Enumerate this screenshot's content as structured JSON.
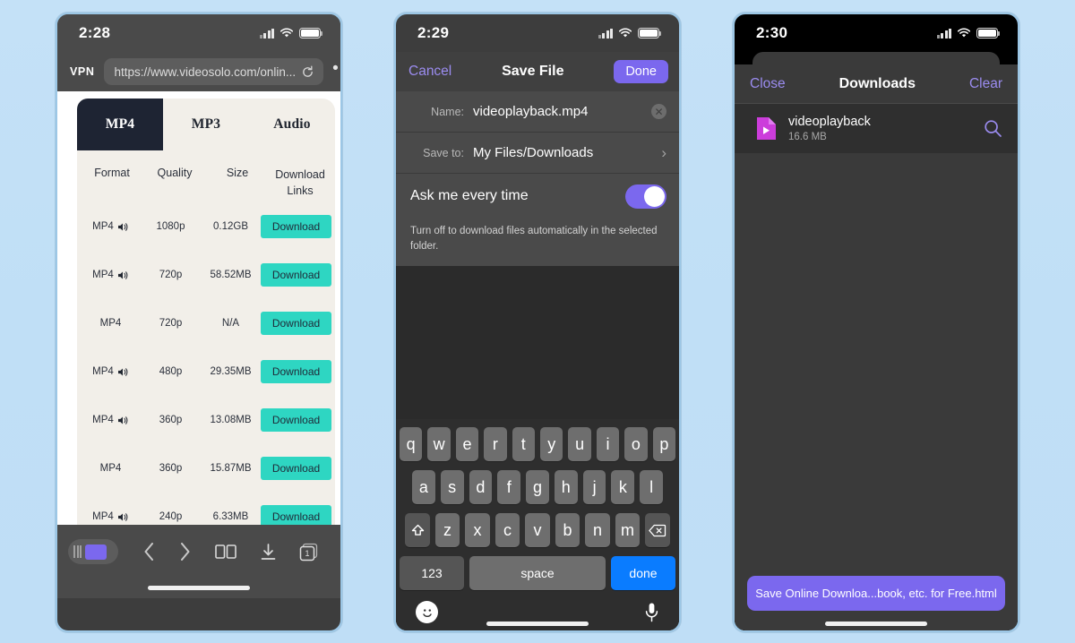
{
  "background_color": "#c0dff6",
  "phone1": {
    "name": "browser-phone",
    "statusbar": {
      "time": "2:28",
      "signal_icon": "cellular-bars-icon",
      "wifi_icon": "wifi-icon",
      "battery_icon": "battery-icon"
    },
    "browser": {
      "vpn_label": "VPN",
      "url": "https://www.videosolo.com/onlin...",
      "reload_icon": "reload-icon",
      "more_icon": "more-dots-icon"
    },
    "tabs": [
      {
        "label": "MP4",
        "active": true
      },
      {
        "label": "MP3",
        "active": false
      },
      {
        "label": "Audio",
        "active": false
      }
    ],
    "table": {
      "headers": [
        "Format",
        "Quality",
        "Size",
        "Download Links"
      ],
      "header_download_line1": "Download",
      "header_download_line2": "Links",
      "rows": [
        {
          "format": "MP4",
          "has_audio_icon": true,
          "quality": "1080p",
          "size": "0.12GB",
          "action": "Download"
        },
        {
          "format": "MP4",
          "has_audio_icon": true,
          "quality": "720p",
          "size": "58.52MB",
          "action": "Download"
        },
        {
          "format": "MP4",
          "has_audio_icon": false,
          "quality": "720p",
          "size": "N/A",
          "action": "Download"
        },
        {
          "format": "MP4",
          "has_audio_icon": true,
          "quality": "480p",
          "size": "29.35MB",
          "action": "Download"
        },
        {
          "format": "MP4",
          "has_audio_icon": true,
          "quality": "360p",
          "size": "13.08MB",
          "action": "Download"
        },
        {
          "format": "MP4",
          "has_audio_icon": false,
          "quality": "360p",
          "size": "15.87MB",
          "action": "Download"
        },
        {
          "format": "MP4",
          "has_audio_icon": true,
          "quality": "240p",
          "size": "6.33MB",
          "action": "Download"
        }
      ]
    },
    "toolbar": {
      "vpn_pill_icon": "vpn-shield-icon",
      "back_icon": "chevron-left-icon",
      "forward_icon": "chevron-right-icon",
      "bookmarks_icon": "book-icon",
      "downloads_icon": "download-arrow-icon",
      "tabs_icon": "tabs-icon",
      "tabs_count": "1"
    },
    "accent_download_button": "#2ed6c2",
    "active_tab_color": "#1e2433",
    "card_background": "#f2efe9"
  },
  "phone2": {
    "name": "save-file-phone",
    "statusbar": {
      "time": "2:29",
      "signal_icon": "cellular-bars-icon",
      "wifi_icon": "wifi-icon",
      "battery_icon": "battery-icon"
    },
    "nav": {
      "cancel_label": "Cancel",
      "title": "Save File",
      "done_label": "Done"
    },
    "fields": [
      {
        "label": "Name:",
        "value": "videoplayback.mp4",
        "clear_icon": "clear-circle-icon"
      },
      {
        "label": "Save to:",
        "value": "My Files/Downloads",
        "chevron_icon": "chevron-right-icon"
      }
    ],
    "toggle": {
      "label": "Ask me every time",
      "state": "on",
      "accent": "#7b68ee"
    },
    "hint": "Turn off to download files automatically in the selected folder.",
    "keyboard": {
      "row1": [
        "q",
        "w",
        "e",
        "r",
        "t",
        "y",
        "u",
        "i",
        "o",
        "p"
      ],
      "row2": [
        "a",
        "s",
        "d",
        "f",
        "g",
        "h",
        "j",
        "k",
        "l"
      ],
      "row3_shift_icon": "shift-icon",
      "row3": [
        "z",
        "x",
        "c",
        "v",
        "b",
        "n",
        "m"
      ],
      "row3_backspace_icon": "backspace-icon",
      "numbers_label": "123",
      "space_label": "space",
      "return_label": "done",
      "emoji_icon": "emoji-smiley-icon",
      "mic_icon": "microphone-icon",
      "return_color": "#0a7cff"
    }
  },
  "phone3": {
    "name": "downloads-phone",
    "statusbar": {
      "time": "2:30",
      "signal_icon": "cellular-bars-icon",
      "wifi_icon": "wifi-icon",
      "battery_icon": "battery-icon"
    },
    "nav": {
      "close_label": "Close",
      "title": "Downloads",
      "clear_label": "Clear"
    },
    "downloads": [
      {
        "file_icon": "video-file-icon",
        "name": "videoplayback",
        "size": "16.6 MB",
        "search_icon": "search-icon"
      }
    ],
    "footer_button": "Save Online Downloa...book, etc. for Free.html",
    "accent": "#7b68ee"
  }
}
